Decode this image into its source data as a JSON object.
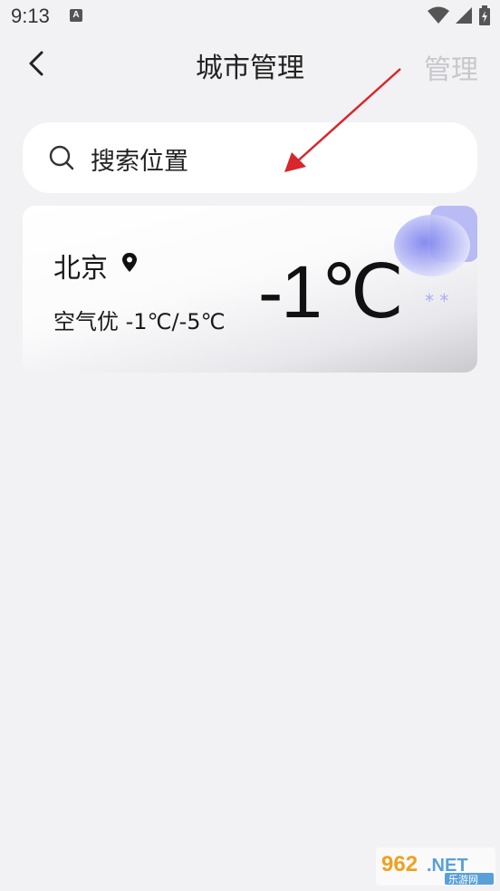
{
  "status_bar": {
    "time": "9:13",
    "notification_icon": "a-notification-icon",
    "icons": [
      "wifi-icon",
      "signal-icon",
      "battery-icon"
    ]
  },
  "header": {
    "back_icon": "chevron-left-icon",
    "title": "城市管理",
    "manage_label": "管理"
  },
  "search": {
    "icon": "search-icon",
    "placeholder": "搜索位置"
  },
  "cities": [
    {
      "name": "北京",
      "location_icon": "location-pin-icon",
      "air_summary": "空气优 -1℃/-5℃",
      "temperature": "-1℃",
      "weather_icon": "cloud-snow-icon"
    }
  ],
  "watermark": {
    "logo_text": "962.NET",
    "sub_text": "乐游网"
  },
  "colors": {
    "background": "#f2f2f4",
    "card_bg": "#ffffff",
    "manage_disabled": "#c8c8cc",
    "annotation_arrow": "#d9262b",
    "weather_accent": "#8c90f0"
  }
}
